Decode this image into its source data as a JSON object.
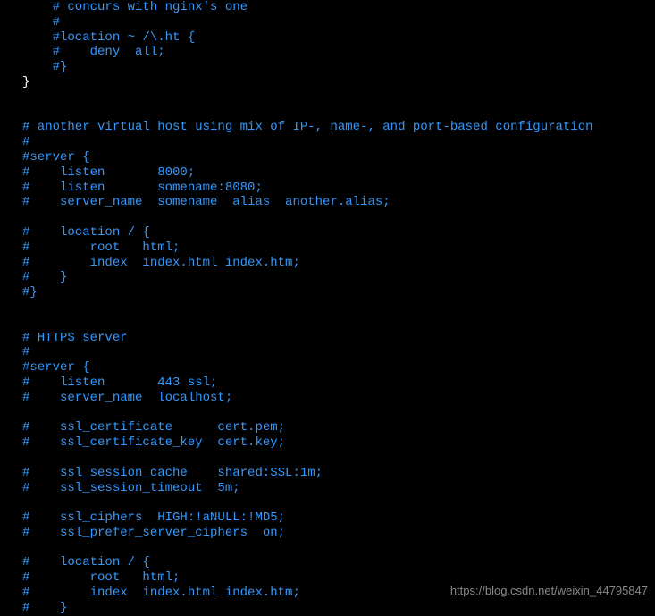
{
  "lines": [
    {
      "indent": "    ",
      "text": "# concurs with nginx's one"
    },
    {
      "indent": "    ",
      "text": "#"
    },
    {
      "indent": "    ",
      "text": "#location ~ /\\.ht {"
    },
    {
      "indent": "    ",
      "text": "#    deny  all;"
    },
    {
      "indent": "    ",
      "text": "#}"
    },
    {
      "indent": "",
      "text": "}",
      "white": true
    },
    {
      "indent": "",
      "text": ""
    },
    {
      "indent": "",
      "text": ""
    },
    {
      "indent": "",
      "text": "# another virtual host using mix of IP-, name-, and port-based configuration"
    },
    {
      "indent": "",
      "text": "#"
    },
    {
      "indent": "",
      "text": "#server {"
    },
    {
      "indent": "",
      "text": "#    listen       8000;"
    },
    {
      "indent": "",
      "text": "#    listen       somename:8080;"
    },
    {
      "indent": "",
      "text": "#    server_name  somename  alias  another.alias;"
    },
    {
      "indent": "",
      "text": ""
    },
    {
      "indent": "",
      "text": "#    location / {"
    },
    {
      "indent": "",
      "text": "#        root   html;"
    },
    {
      "indent": "",
      "text": "#        index  index.html index.htm;"
    },
    {
      "indent": "",
      "text": "#    }"
    },
    {
      "indent": "",
      "text": "#}"
    },
    {
      "indent": "",
      "text": ""
    },
    {
      "indent": "",
      "text": ""
    },
    {
      "indent": "",
      "text": "# HTTPS server"
    },
    {
      "indent": "",
      "text": "#"
    },
    {
      "indent": "",
      "text": "#server {"
    },
    {
      "indent": "",
      "text": "#    listen       443 ssl;"
    },
    {
      "indent": "",
      "text": "#    server_name  localhost;"
    },
    {
      "indent": "",
      "text": ""
    },
    {
      "indent": "",
      "text": "#    ssl_certificate      cert.pem;"
    },
    {
      "indent": "",
      "text": "#    ssl_certificate_key  cert.key;"
    },
    {
      "indent": "",
      "text": ""
    },
    {
      "indent": "",
      "text": "#    ssl_session_cache    shared:SSL:1m;"
    },
    {
      "indent": "",
      "text": "#    ssl_session_timeout  5m;"
    },
    {
      "indent": "",
      "text": ""
    },
    {
      "indent": "",
      "text": "#    ssl_ciphers  HIGH:!aNULL:!MD5;"
    },
    {
      "indent": "",
      "text": "#    ssl_prefer_server_ciphers  on;"
    },
    {
      "indent": "",
      "text": ""
    },
    {
      "indent": "",
      "text": "#    location / {"
    },
    {
      "indent": "",
      "text": "#        root   html;"
    },
    {
      "indent": "",
      "text": "#        index  index.html index.htm;"
    },
    {
      "indent": "",
      "text": "#    }"
    }
  ],
  "watermark": "https://blog.csdn.net/weixin_44795847"
}
